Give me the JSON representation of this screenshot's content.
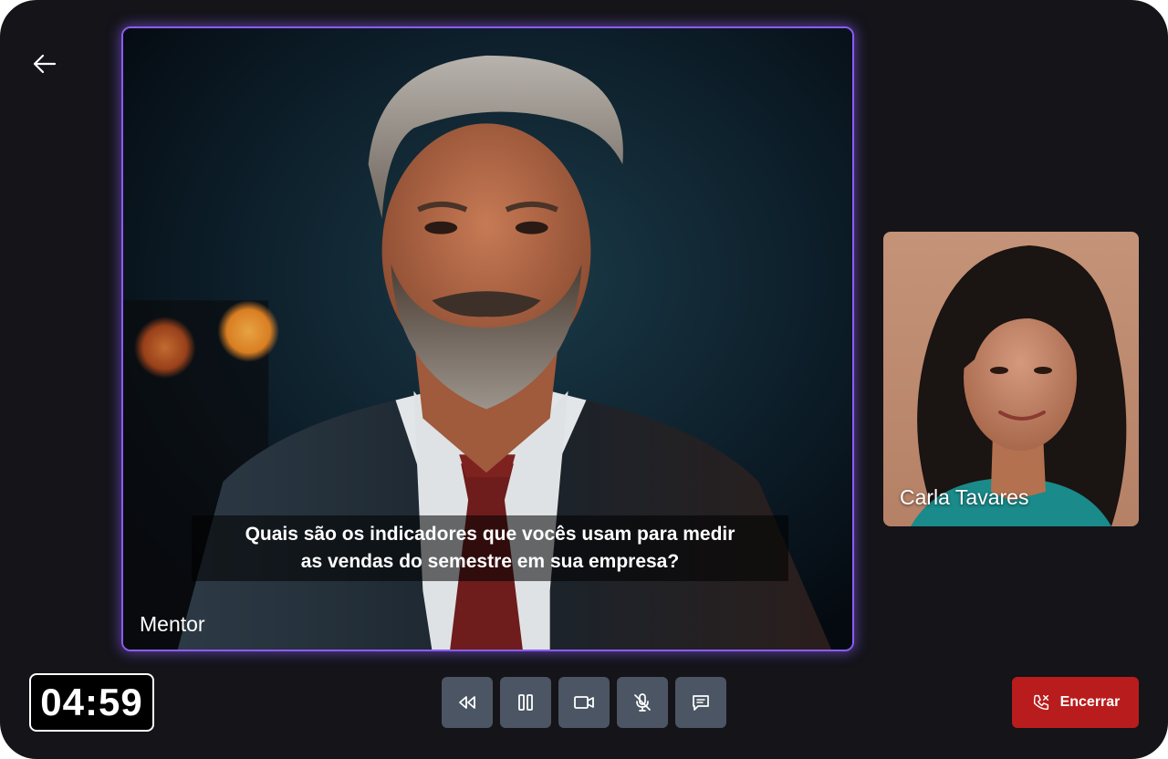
{
  "navigation": {
    "back_icon": "arrow-left-icon"
  },
  "main_video": {
    "caption_line1": "Quais são os indicadores que vocês usam para medir",
    "caption_line2": "as vendas do semestre em sua empresa?",
    "participant_name": "Mentor",
    "border_color": "#8b5cf6"
  },
  "side_video": {
    "participant_name": "Carla Tavares"
  },
  "timer": {
    "value": "04:59"
  },
  "controls": [
    {
      "name": "rewind",
      "icon": "rewind-icon"
    },
    {
      "name": "pause",
      "icon": "pause-icon"
    },
    {
      "name": "camera",
      "icon": "video-camera-icon"
    },
    {
      "name": "microphone-muted",
      "icon": "microphone-off-icon"
    },
    {
      "name": "chat",
      "icon": "chat-icon"
    }
  ],
  "end_call": {
    "label": "Encerrar",
    "icon": "phone-end-icon",
    "color": "#b91c1c"
  }
}
